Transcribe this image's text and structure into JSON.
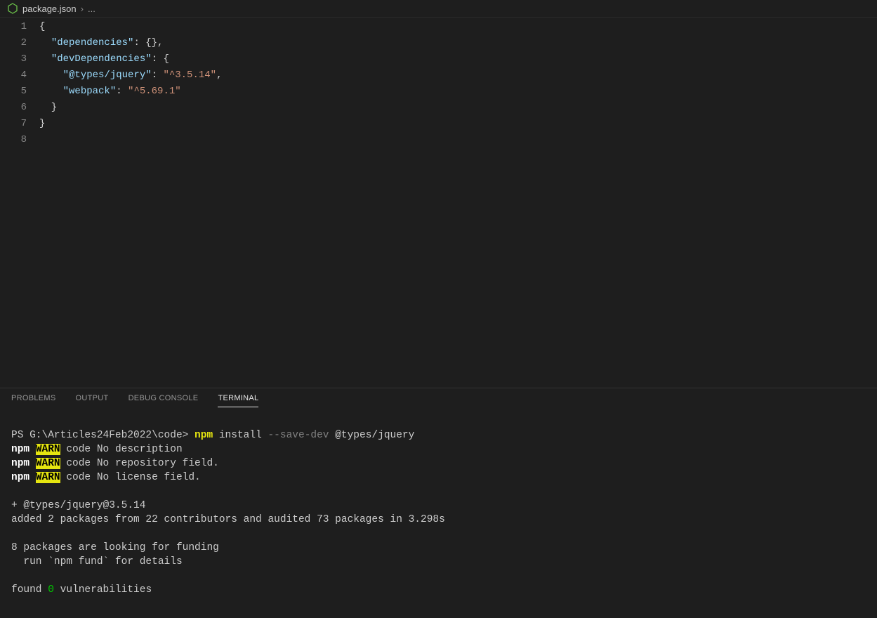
{
  "breadcrumb": {
    "file": "package.json",
    "separator": "›",
    "ellipsis": "..."
  },
  "code": {
    "lines": [
      {
        "n": "1",
        "tokens": [
          {
            "t": "{",
            "c": "tok-brace"
          }
        ]
      },
      {
        "n": "2",
        "tokens": [
          {
            "t": "  ",
            "c": ""
          },
          {
            "t": "\"dependencies\"",
            "c": "tok-key"
          },
          {
            "t": ": {},",
            "c": "tok-punc"
          }
        ]
      },
      {
        "n": "3",
        "tokens": [
          {
            "t": "  ",
            "c": ""
          },
          {
            "t": "\"devDependencies\"",
            "c": "tok-key"
          },
          {
            "t": ": {",
            "c": "tok-punc"
          }
        ]
      },
      {
        "n": "4",
        "tokens": [
          {
            "t": "    ",
            "c": ""
          },
          {
            "t": "\"@types/jquery\"",
            "c": "tok-key"
          },
          {
            "t": ": ",
            "c": "tok-punc"
          },
          {
            "t": "\"^3.5.14\"",
            "c": "tok-str"
          },
          {
            "t": ",",
            "c": "tok-punc"
          }
        ]
      },
      {
        "n": "5",
        "tokens": [
          {
            "t": "    ",
            "c": ""
          },
          {
            "t": "\"webpack\"",
            "c": "tok-key"
          },
          {
            "t": ": ",
            "c": "tok-punc"
          },
          {
            "t": "\"^5.69.1\"",
            "c": "tok-str"
          }
        ]
      },
      {
        "n": "6",
        "tokens": [
          {
            "t": "  }",
            "c": "tok-brace"
          }
        ]
      },
      {
        "n": "7",
        "tokens": [
          {
            "t": "}",
            "c": "tok-brace"
          }
        ]
      },
      {
        "n": "8",
        "tokens": [
          {
            "t": "",
            "c": ""
          }
        ]
      }
    ]
  },
  "panel": {
    "tabs": {
      "problems": "PROBLEMS",
      "output": "OUTPUT",
      "debug": "DEBUG CONSOLE",
      "terminal": "TERMINAL"
    }
  },
  "terminal": {
    "prompt_prefix": "PS G:\\Articles24Feb2022\\code>",
    "cmd_npm": "npm",
    "cmd_install": " install ",
    "cmd_flag": "--save-dev",
    "cmd_pkg": " @types/jquery",
    "warn_npm": "npm",
    "warn_tag": "WARN",
    "warn1": " code No description",
    "warn2": " code No repository field.",
    "warn3": " code No license field.",
    "added_pkg": "+ @types/jquery@3.5.14",
    "added_line": "added 2 packages from 22 contributors and audited 73 packages in 3.298s",
    "funding1": "8 packages are looking for funding",
    "funding2": "  run `npm fund` for details",
    "vuln_found": "found ",
    "vuln_zero": "0",
    "vuln_rest": " vulnerabilities"
  }
}
